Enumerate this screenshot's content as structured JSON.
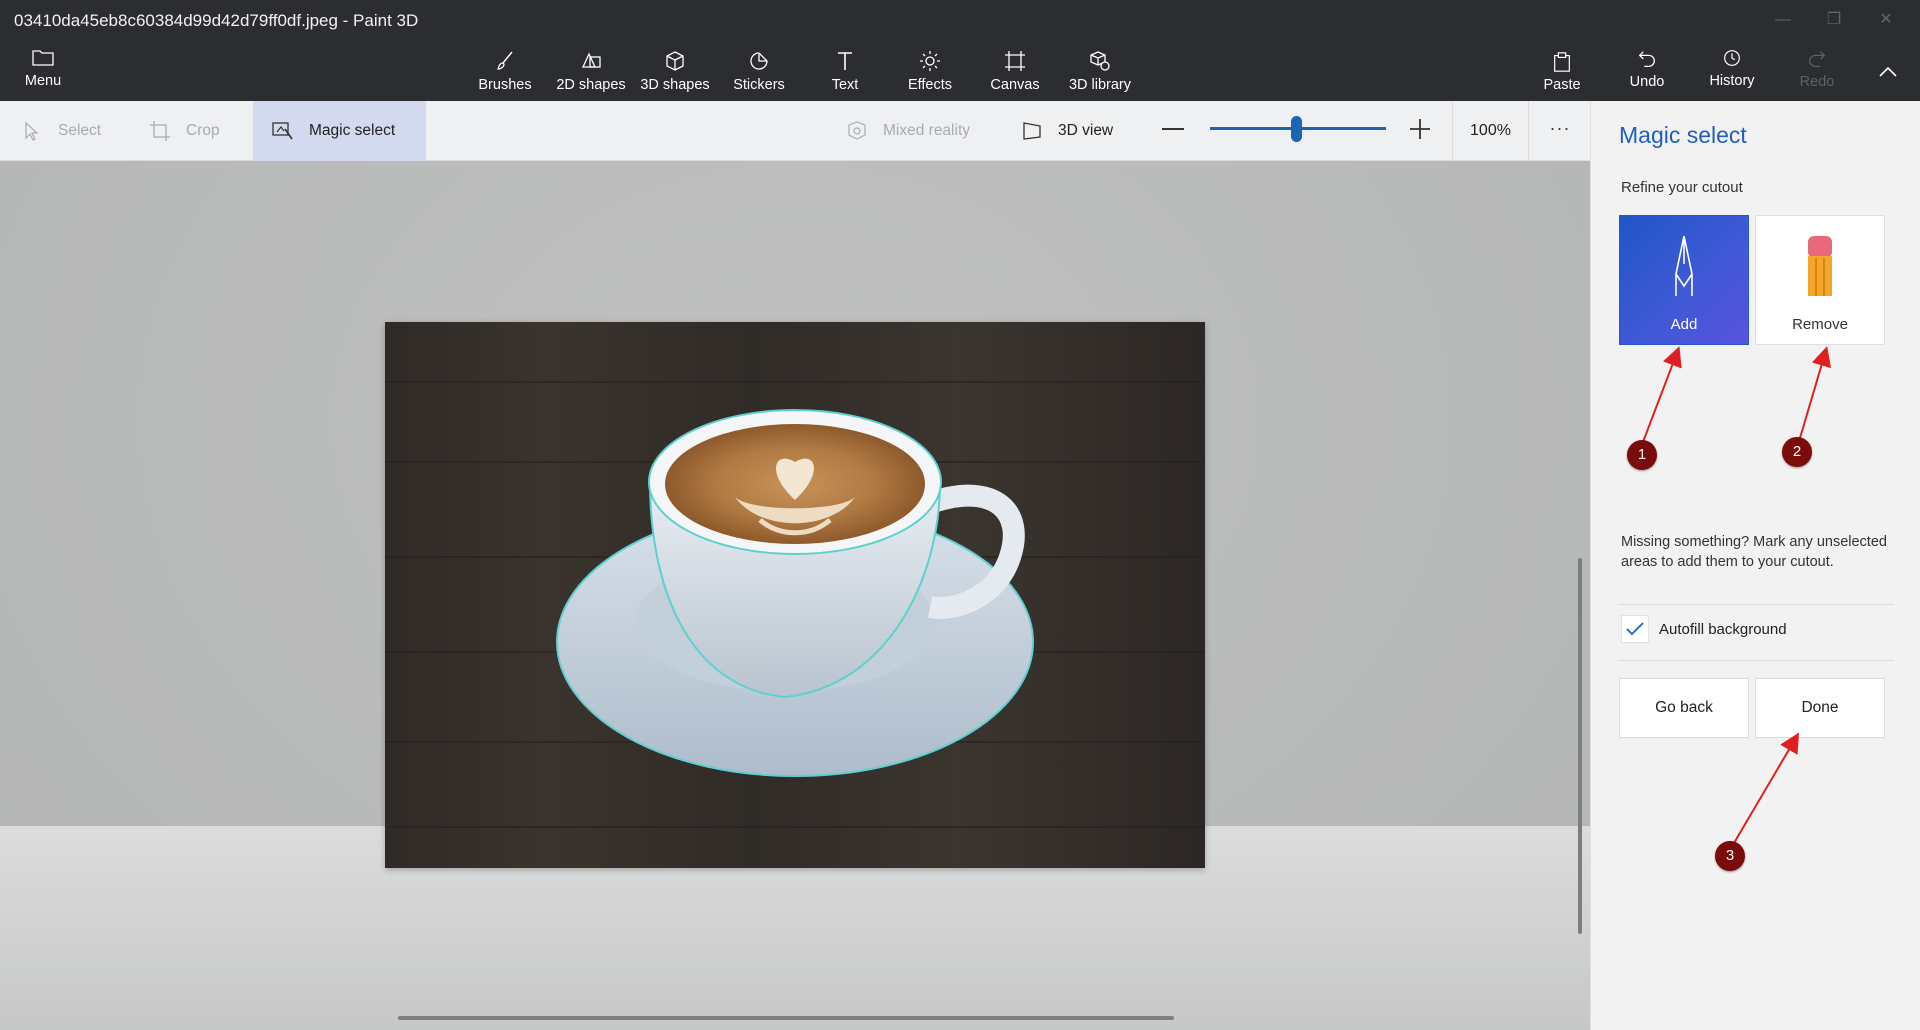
{
  "window": {
    "title": "03410da45eb8c60384d99d42d79ff0df.jpeg - Paint 3D"
  },
  "ribbon": {
    "menu_label": "Menu",
    "tools": [
      {
        "label": "Brushes",
        "icon": "brush-icon"
      },
      {
        "label": "2D shapes",
        "icon": "2d-shapes-icon"
      },
      {
        "label": "3D shapes",
        "icon": "3d-shapes-icon"
      },
      {
        "label": "Stickers",
        "icon": "stickers-icon"
      },
      {
        "label": "Text",
        "icon": "text-icon"
      },
      {
        "label": "Effects",
        "icon": "effects-icon"
      },
      {
        "label": "Canvas",
        "icon": "canvas-icon"
      },
      {
        "label": "3D library",
        "icon": "3d-library-icon"
      }
    ],
    "right_tools": [
      {
        "label": "Paste",
        "icon": "paste-icon",
        "enabled": true
      },
      {
        "label": "Undo",
        "icon": "undo-icon",
        "enabled": true
      },
      {
        "label": "History",
        "icon": "history-icon",
        "enabled": true
      },
      {
        "label": "Redo",
        "icon": "redo-icon",
        "enabled": false
      }
    ]
  },
  "toolbar": {
    "select_label": "Select",
    "crop_label": "Crop",
    "magic_select_label": "Magic select",
    "mixed_reality_label": "Mixed reality",
    "view_3d_label": "3D view",
    "zoom_value": "100%",
    "zoom_slider_fraction": 0.5,
    "more_label": "···"
  },
  "panel": {
    "title": "Magic select",
    "subtitle": "Refine your cutout",
    "add_label": "Add",
    "remove_label": "Remove",
    "help_text": "Missing something? Mark any unselected areas to add them to your cutout.",
    "autofill_label": "Autofill background",
    "autofill_checked": true,
    "go_back_label": "Go back",
    "done_label": "Done"
  },
  "annotations": {
    "badges": [
      "1",
      "2",
      "3"
    ],
    "color": "#7b0c0c",
    "arrow_color": "#e02020"
  },
  "colors": {
    "accent": "#1e64b4",
    "title_bar": "#2b2d31",
    "panel_title": "#1f5fbf"
  }
}
